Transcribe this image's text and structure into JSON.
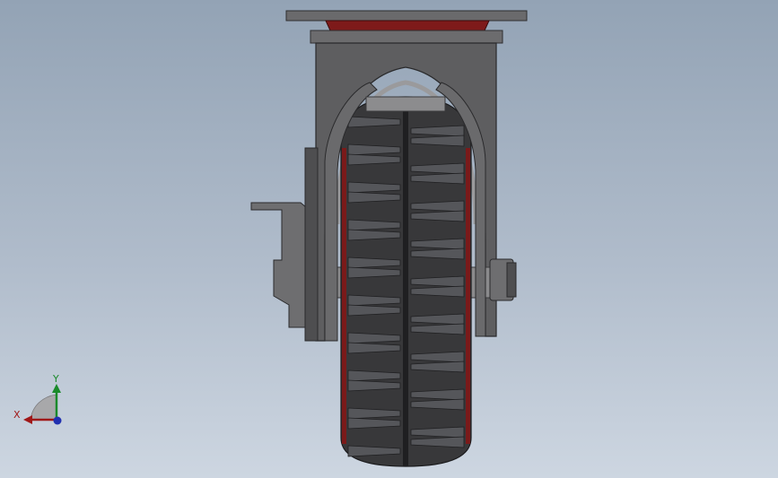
{
  "viewport": {
    "background_top": "#93a3b5",
    "background_bottom": "#cdd6e1"
  },
  "model": {
    "icon": "caster-wheel-model",
    "colors": {
      "metal": "#5c5c5e",
      "metal_dark": "#3c3c3e",
      "metal_light": "#8a8a8c",
      "tire": "#3a3a3c",
      "tire_dark": "#1f1f21",
      "tread_light": "#55565a",
      "rim_red": "#8b1a1a"
    }
  },
  "triad": {
    "icon": "coordinate-triad-icon",
    "x_label": "X",
    "y_label": "Y",
    "x_color": "#a01818",
    "y_color": "#1a8a2a",
    "z_color": "#2030b0"
  }
}
